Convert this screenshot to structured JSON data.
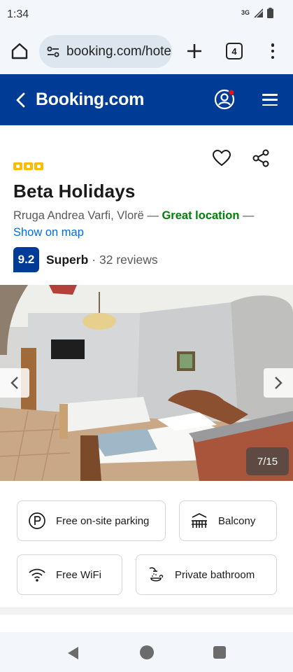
{
  "status_bar": {
    "time": "1:34",
    "network": "3G"
  },
  "browser": {
    "url": "booking.com/hotel",
    "tab_count": "4"
  },
  "header": {
    "logo": "Booking.com"
  },
  "property": {
    "star_count": 3,
    "name": "Beta Holidays",
    "address": "Rruga Andrea Varfi, Vlorë",
    "separator": " — ",
    "location_badge": "Great location",
    "map_link": "Show on map",
    "review_score": "9.2",
    "rating_word": "Superb",
    "review_count": "· 32 reviews"
  },
  "gallery": {
    "counter": "7/15"
  },
  "facilities": [
    {
      "label": "Free on-site parking",
      "icon": "parking-icon"
    },
    {
      "label": "Balcony",
      "icon": "balcony-icon"
    },
    {
      "label": "Free WiFi",
      "icon": "wifi-icon"
    },
    {
      "label": "Private bathroom",
      "icon": "bathroom-icon"
    }
  ],
  "colors": {
    "brand_blue": "#003b95",
    "link_blue": "#006ce4",
    "great_green": "#008009",
    "star_yellow": "#febb02"
  }
}
